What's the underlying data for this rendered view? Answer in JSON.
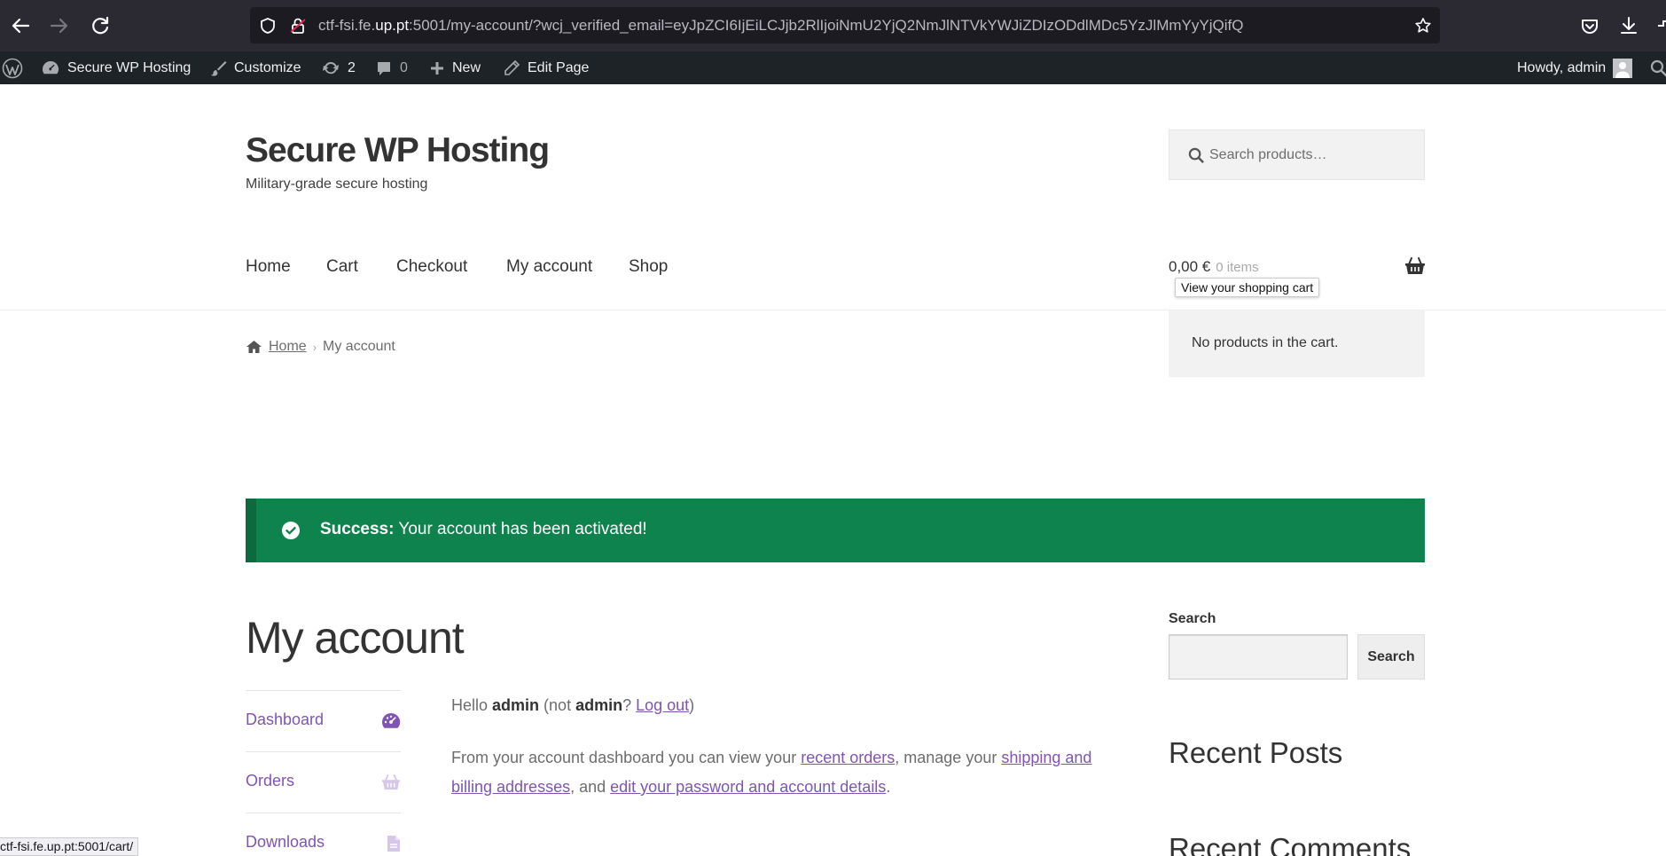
{
  "browser": {
    "url_prefix": "ctf-fsi.fe.",
    "url_host": "up.pt",
    "url_rest": ":5001/my-account/?wcj_verified_email=eyJpZCI6IjEiLCJjb2RlIjoiNmU2YjQ2NmJlNTVkYWJiZDIzODdlMDc5YzJlMmYyYjQifQ",
    "status_url": "ctf-fsi.fe.up.pt:5001/cart/"
  },
  "adminbar": {
    "site_name": "Secure WP Hosting",
    "customize": "Customize",
    "updates_count": "2",
    "comments_count": "0",
    "new": "New",
    "edit_page": "Edit Page",
    "howdy": "Howdy, admin"
  },
  "site": {
    "title": "Secure WP Hosting",
    "description": "Military-grade secure hosting",
    "search_placeholder": "Search products…"
  },
  "nav": {
    "items": [
      "Home",
      "Cart",
      "Checkout",
      "My account",
      "Shop"
    ]
  },
  "cart": {
    "amount": "0,00 €",
    "count": "0 items",
    "tooltip": "View your shopping cart",
    "empty_text": "No products in the cart."
  },
  "breadcrumb": {
    "home": "Home",
    "current": "My account"
  },
  "notice": {
    "label": "Success:",
    "message": " Your account has been activated!",
    "color": "#0f834d"
  },
  "account": {
    "page_title": "My account",
    "nav_items": [
      "Dashboard",
      "Orders",
      "Downloads"
    ],
    "hello_prefix": "Hello ",
    "username": "admin",
    "not_prefix": " (not ",
    "not_username": "admin",
    "not_suffix": "? ",
    "logout": "Log out",
    "close_paren": ")",
    "dash_prefix": "From your account dashboard you can view your ",
    "recent_orders": "recent orders",
    "manage": ", manage your ",
    "addresses": "shipping and billing addresses",
    "and": ", and ",
    "edit_details": "edit your password and account details",
    "period": "."
  },
  "sidebar": {
    "search_label": "Search",
    "search_button": "Search",
    "recent_posts": "Recent Posts",
    "recent_comments": "Recent Comments"
  },
  "colors": {
    "accent": "#7f54b3",
    "adminbar": "#1d2327",
    "browser": "#2b2a33"
  }
}
